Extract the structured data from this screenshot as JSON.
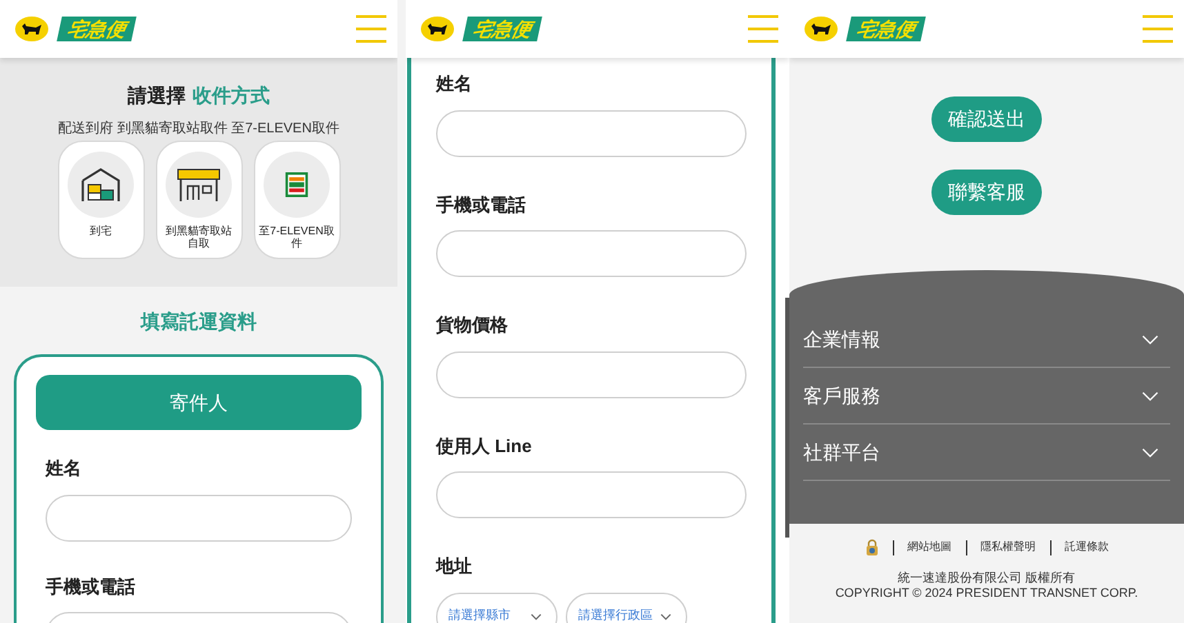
{
  "screens": [
    {
      "kind": "delivery_method",
      "header": {
        "logo_text": "宅急便"
      },
      "heading_prefix": "請選擇",
      "heading_highlight": "收件方式",
      "options_caption": "配送到府 到黑貓寄取站取件 至7-ELEVEN取件",
      "options": [
        {
          "kind": "home",
          "label": "到宅"
        },
        {
          "kind": "station",
          "label": "到黑貓寄取站自取"
        },
        {
          "kind": "seven",
          "label": "至7-ELEVEN取件"
        }
      ],
      "form_title": "填寫託運資料",
      "section_button": "寄件人",
      "fields": [
        {
          "label": "姓名"
        },
        {
          "label": "手機或電話"
        }
      ]
    },
    {
      "kind": "recipient_form",
      "header": {
        "logo_text": "宅急便"
      },
      "fields": [
        {
          "label": "姓名"
        },
        {
          "label": "手機或電話"
        },
        {
          "label": "貨物價格"
        },
        {
          "label": "使用人 Line"
        }
      ],
      "address": {
        "label": "地址",
        "selects": [
          {
            "prompt": "請選擇縣市"
          },
          {
            "prompt": "請選擇行政區"
          }
        ]
      }
    },
    {
      "kind": "footer",
      "header": {
        "logo_text": "宅急便"
      },
      "buttons": [
        "確認送出",
        "聯繫客服"
      ],
      "footer_menu": [
        {
          "label": "企業情報",
          "expanded": false
        },
        {
          "label": "客戶服務",
          "expanded": false
        },
        {
          "label": "社群平台",
          "expanded": false
        }
      ],
      "links": [
        "網站地圖",
        "隱私權聲明",
        "託運條款"
      ],
      "company": "統一速達股份有限公司 版權所有",
      "copyright": "COPYRIGHT © 2024 PRESIDENT TRANSNET CORP."
    }
  ]
}
